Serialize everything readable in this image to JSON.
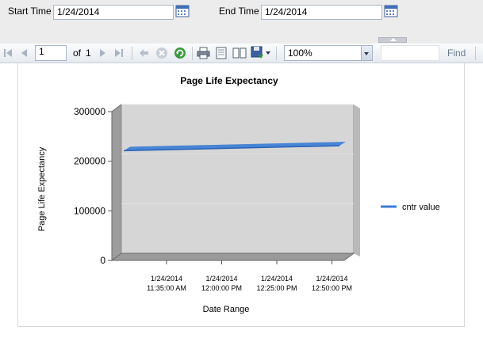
{
  "parameters": {
    "start_label": "Start Time",
    "start_value": "1/24/2014",
    "end_label": "End Time",
    "end_value": "1/24/2014"
  },
  "toolbar": {
    "page_current": "1",
    "page_of_label": "of",
    "page_total": "1",
    "zoom": "100%",
    "find_label": "Find",
    "find_placeholder": "",
    "icons": [
      "first-page-icon",
      "prev-page-icon",
      "next-page-icon",
      "last-page-icon",
      "back-icon",
      "stop-icon",
      "refresh-icon",
      "print-icon",
      "print-layout-icon",
      "page-setup-icon",
      "export-icon"
    ]
  },
  "chart_data": {
    "type": "line",
    "title": "Page Life Expectancy",
    "xlabel": "Date Range",
    "ylabel": "Page Life Expectancy",
    "ylim": [
      0,
      300000
    ],
    "yticks": [
      0,
      100000,
      200000,
      300000
    ],
    "ytick_labels": [
      "0",
      "100000",
      "200000",
      "300000"
    ],
    "xticks": [
      {
        "line1": "1/24/2014",
        "line2": "11:35:00 AM"
      },
      {
        "line1": "1/24/2014",
        "line2": "12:00:00 PM"
      },
      {
        "line1": "1/24/2014",
        "line2": "12:25:00 PM"
      },
      {
        "line1": "1/24/2014",
        "line2": "12:50:00 PM"
      }
    ],
    "series": [
      {
        "name": "cntr value",
        "color": "#3a7bd5",
        "start": 218000,
        "end": 228000
      }
    ],
    "legend": "right",
    "grid": true,
    "style": "3d"
  }
}
